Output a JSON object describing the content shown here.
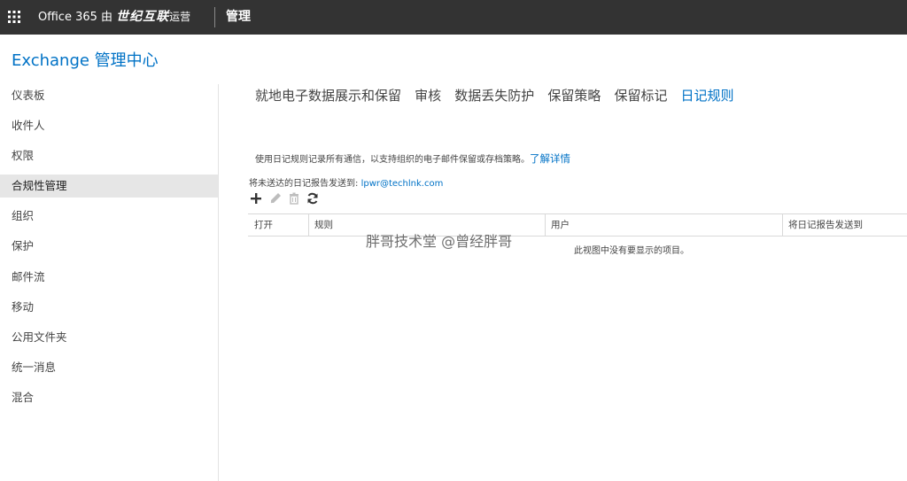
{
  "topbar": {
    "app_name": "Office 365 由",
    "operator": "世纪互联",
    "operated": "运营",
    "admin_label": "管理",
    "bg_color": "#333333"
  },
  "header": {
    "title": "Exchange 管理中心"
  },
  "sidebar": {
    "items": [
      {
        "label": "仪表板"
      },
      {
        "label": "收件人"
      },
      {
        "label": "权限"
      },
      {
        "label": "合规性管理",
        "selected": true
      },
      {
        "label": "组织"
      },
      {
        "label": "保护"
      },
      {
        "label": "邮件流"
      },
      {
        "label": "移动"
      },
      {
        "label": "公用文件夹"
      },
      {
        "label": "统一消息"
      },
      {
        "label": "混合"
      }
    ]
  },
  "tabs": [
    {
      "label": "就地电子数据展示和保留"
    },
    {
      "label": "审核"
    },
    {
      "label": "数据丢失防护"
    },
    {
      "label": "保留策略"
    },
    {
      "label": "保留标记"
    },
    {
      "label": "日记规则",
      "active": true
    }
  ],
  "main": {
    "description": "使用日记规则记录所有通信，以支持组织的电子邮件保留或存档策略。",
    "learn_more": "了解详情",
    "undeliverable_label": "将未送达的日记报告发送到:",
    "undeliverable_email": "lpwr@techlnk.com",
    "toolbar": {
      "add": "plus-icon",
      "edit": "pencil-icon",
      "delete": "trash-icon",
      "refresh": "refresh-icon"
    },
    "table": {
      "columns": [
        "打开",
        "规则",
        "用户",
        "将日记报告发送到"
      ],
      "empty_message": "此视图中没有要显示的项目。"
    }
  },
  "watermark": "胖哥技术堂 @曾经胖哥",
  "colors": {
    "accent": "#0072c6",
    "selected_bg": "#e6e6e6"
  }
}
